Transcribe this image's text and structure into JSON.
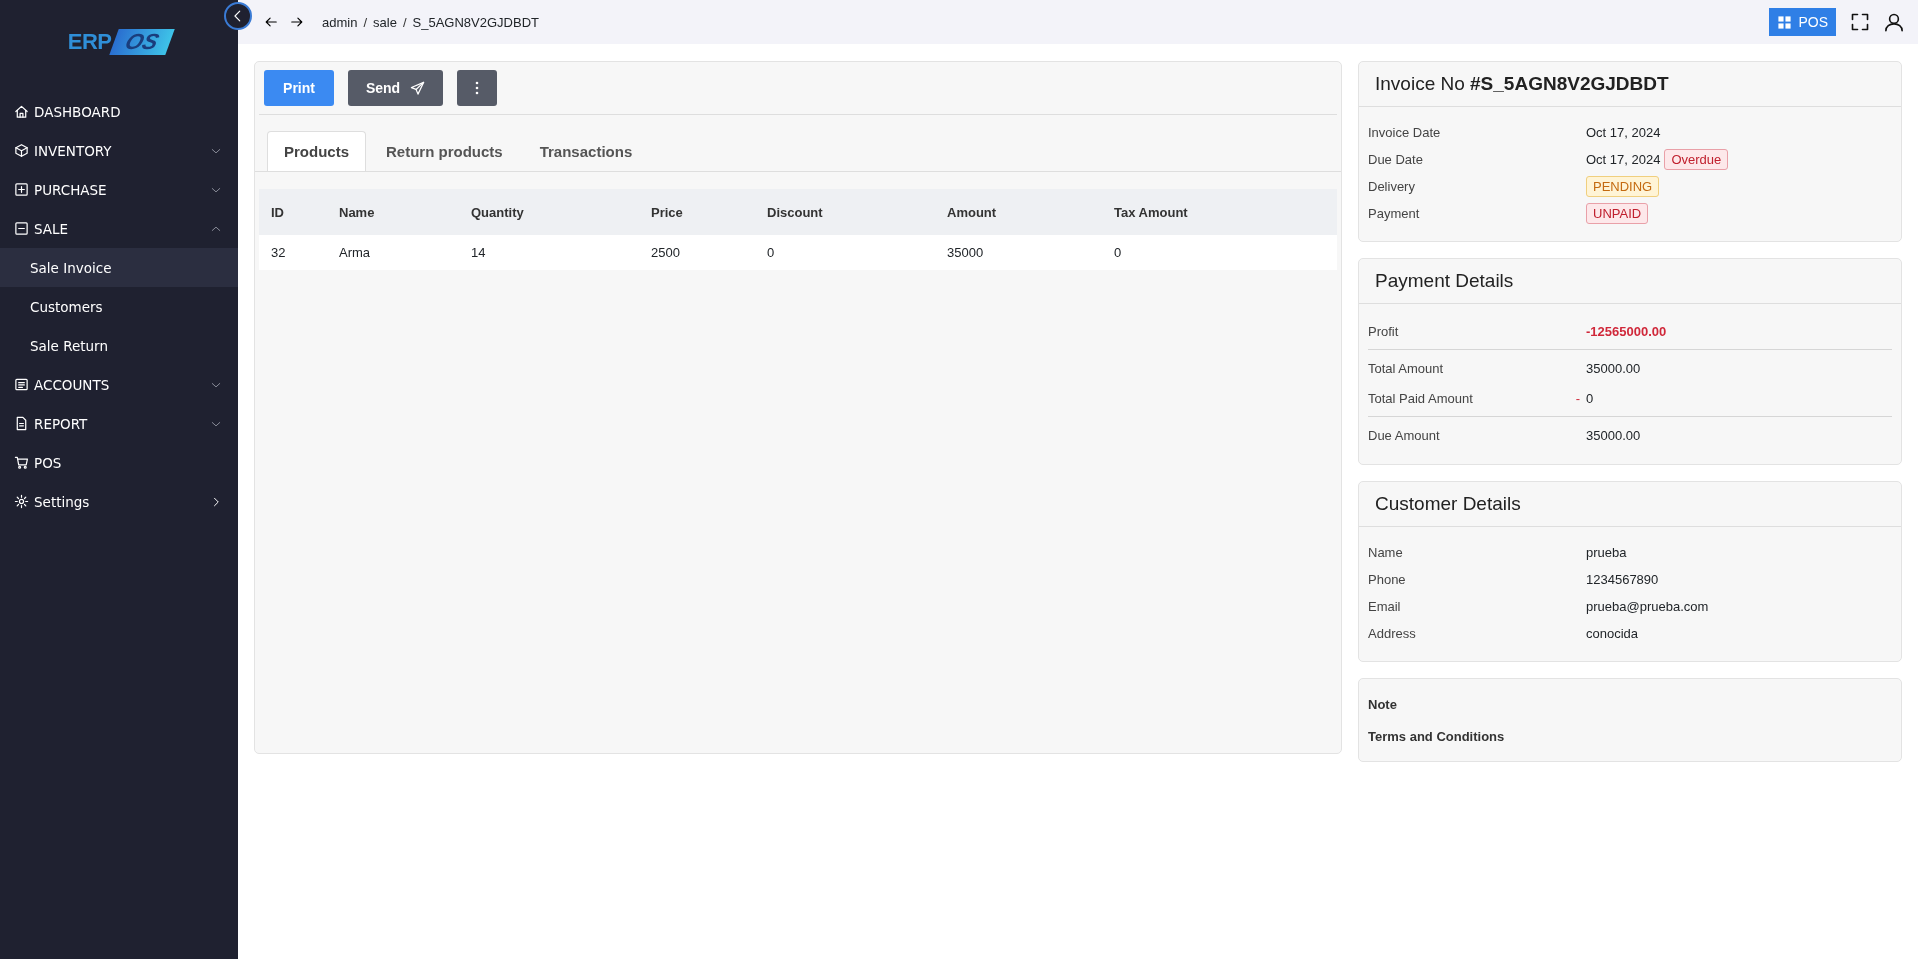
{
  "sidebar": {
    "logo": {
      "left": "ERP",
      "right": "OS"
    },
    "items": [
      {
        "label": "DASHBOARD",
        "kind": "link"
      },
      {
        "label": "INVENTORY",
        "kind": "group",
        "expanded": false
      },
      {
        "label": "PURCHASE",
        "kind": "group",
        "expanded": false
      },
      {
        "label": "SALE",
        "kind": "group",
        "expanded": true,
        "children": [
          {
            "label": "Sale Invoice",
            "selected": true
          },
          {
            "label": "Customers",
            "selected": false
          },
          {
            "label": "Sale Return",
            "selected": false
          }
        ]
      },
      {
        "label": "ACCOUNTS",
        "kind": "group",
        "expanded": false
      },
      {
        "label": "REPORT",
        "kind": "group",
        "expanded": false
      },
      {
        "label": "POS",
        "kind": "link"
      },
      {
        "label": "Settings",
        "kind": "submenu"
      }
    ]
  },
  "topbar": {
    "breadcrumb": [
      "admin",
      "sale",
      "S_5AGN8V2GJDBDT"
    ],
    "separator": "/",
    "pos_button": "POS"
  },
  "toolbar": {
    "print": "Print",
    "send": "Send"
  },
  "tabs": [
    {
      "label": "Products",
      "selected": true
    },
    {
      "label": "Return products",
      "selected": false
    },
    {
      "label": "Transactions",
      "selected": false
    }
  ],
  "table": {
    "columns": [
      "ID",
      "Name",
      "Quantity",
      "Price",
      "Discount",
      "Amount",
      "Tax Amount"
    ],
    "rows": [
      [
        "32",
        "Arma",
        "14",
        "2500",
        "0",
        "35000",
        "0"
      ]
    ]
  },
  "invoice": {
    "title": "Invoice No",
    "number": "#S_5AGN8V2GJDBDT",
    "rows": [
      {
        "label": "Invoice Date",
        "value": "Oct 17, 2024"
      },
      {
        "label": "Due Date",
        "value": "Oct 17, 2024",
        "badge": {
          "text": "Overdue",
          "kind": "danger"
        }
      },
      {
        "label": "Delivery",
        "badge": {
          "text": "PENDING",
          "kind": "warning"
        }
      },
      {
        "label": "Payment",
        "badge": {
          "text": "UNPAID",
          "kind": "danger"
        }
      }
    ]
  },
  "payment": {
    "title": "Payment Details",
    "rows": [
      {
        "label": "Profit",
        "value": "-12565000.00",
        "negative": true,
        "divider_after": true
      },
      {
        "label": "Total Amount",
        "value": "35000.00",
        "negative": false,
        "divider_after": false
      },
      {
        "label": "Total Paid Amount",
        "prefix": "-",
        "value": "0",
        "negative": false,
        "divider_after": true
      },
      {
        "label": "Due Amount",
        "value": "35000.00",
        "negative": false,
        "divider_after": false
      }
    ]
  },
  "customer": {
    "title": "Customer Details",
    "rows": [
      {
        "label": "Name",
        "value": "prueba"
      },
      {
        "label": "Phone",
        "value": "1234567890"
      },
      {
        "label": "Email",
        "value": "prueba@prueba.com"
      },
      {
        "label": "Address",
        "value": "conocida"
      }
    ]
  },
  "notes": [
    "Note",
    "Terms and Conditions"
  ]
}
